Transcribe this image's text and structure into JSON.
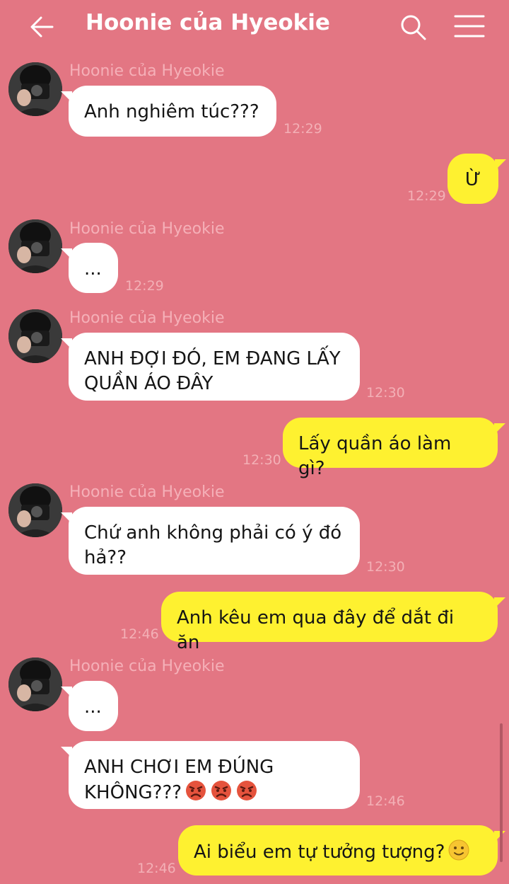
{
  "header": {
    "title": "Hoonie của Hyeokie"
  },
  "contact": {
    "name": "Hoonie của Hyeokie"
  },
  "messages": [
    {
      "text": "Anh nghiêm túc???",
      "time": "12:29"
    },
    {
      "text": "Ừ",
      "time": "12:29"
    },
    {
      "text": "...",
      "time": "12:29"
    },
    {
      "text": "ANH ĐỢI ĐÓ, EM ĐANG LẤY\nQUẦN ÁO ĐÂY",
      "time": "12:30"
    },
    {
      "text": "Lấy quần áo làm gì?",
      "time": "12:30"
    },
    {
      "text": "Chứ anh không phải có ý đó\nhả??",
      "time": "12:30"
    },
    {
      "text": "Anh kêu em qua đây để dắt đi ăn",
      "time": "12:46"
    },
    {
      "text": "...",
      "time": ""
    },
    {
      "text": "ANH CHƠI EM ĐÚNG\nKHÔNG???",
      "time": "12:46"
    },
    {
      "text": "Ai biểu em tự tưởng tượng?",
      "time": "12:46"
    }
  ],
  "colors": {
    "background": "#e37683",
    "incoming_bubble": "#ffffff",
    "outgoing_bubble": "#fef130"
  },
  "icons": {
    "back": "back-arrow-icon",
    "search": "search-icon",
    "menu": "hamburger-menu-icon",
    "angry": "angry-face-emoji",
    "smile": "slight-smile-emoji"
  }
}
